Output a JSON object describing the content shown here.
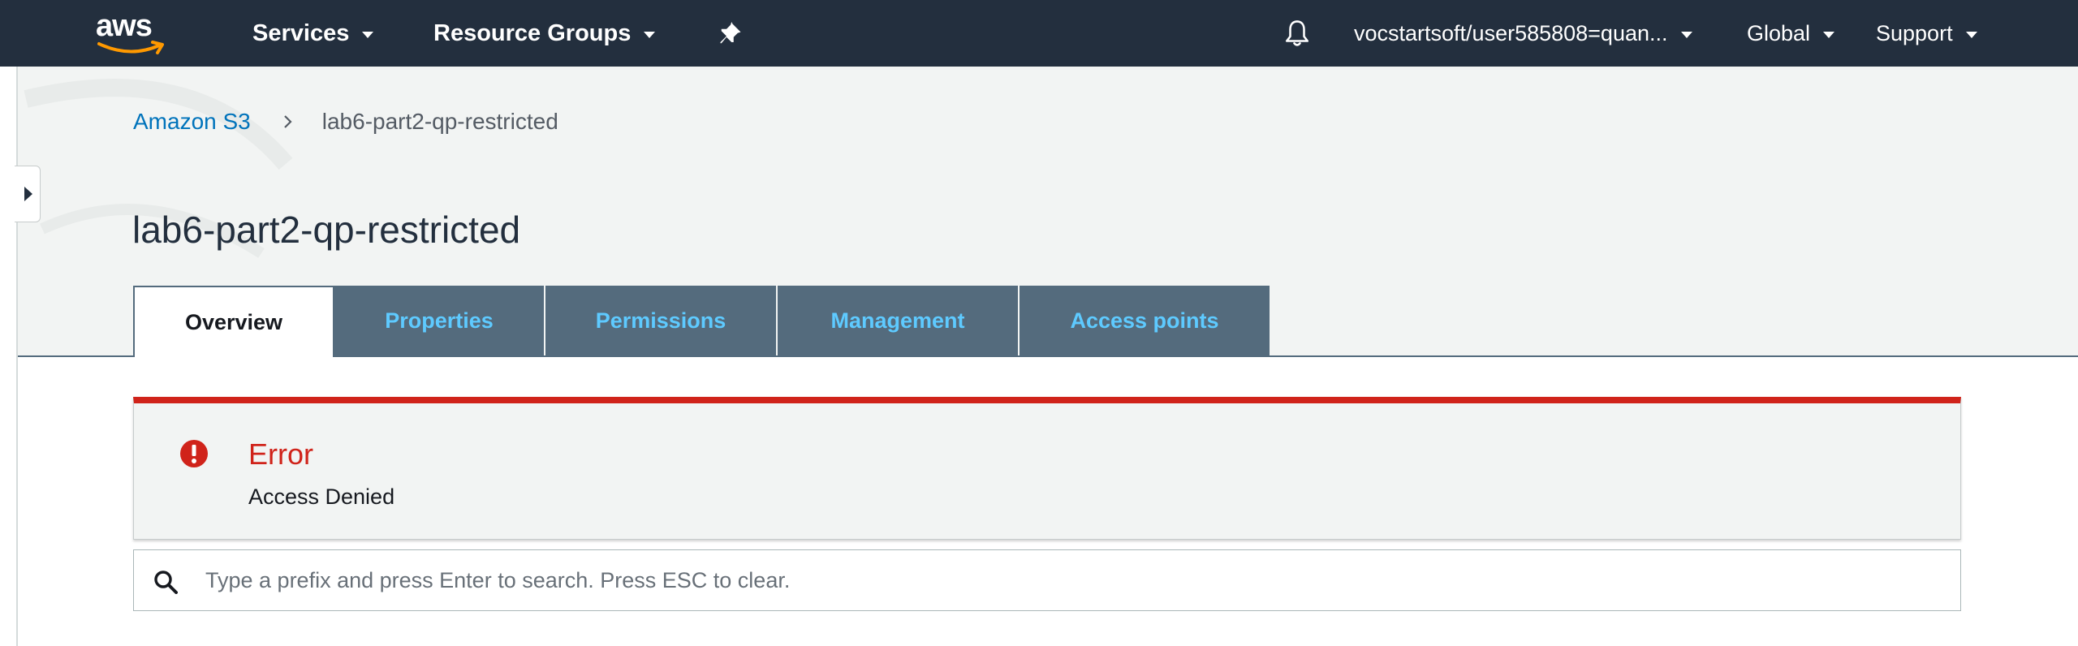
{
  "nav": {
    "brand": "aws",
    "services": "Services",
    "resource_groups": "Resource Groups",
    "account": "vocstartsoft/user585808=quan...",
    "region": "Global",
    "support": "Support",
    "icons": [
      "pin-icon",
      "bell-icon",
      "caret-down-icon"
    ]
  },
  "breadcrumb": {
    "root": "Amazon S3",
    "current": "lab6-part2-qp-restricted"
  },
  "page": {
    "title": "lab6-part2-qp-restricted"
  },
  "tabs": [
    {
      "label": "Overview",
      "active": true
    },
    {
      "label": "Properties",
      "active": false
    },
    {
      "label": "Permissions",
      "active": false
    },
    {
      "label": "Management",
      "active": false
    },
    {
      "label": "Access points",
      "active": false
    }
  ],
  "alert": {
    "title": "Error",
    "message": "Access Denied",
    "icon": "error-icon"
  },
  "search": {
    "placeholder": "Type a prefix and press Enter to search. Press ESC to clear.",
    "value": ""
  },
  "colors": {
    "nav_bg": "#232f3e",
    "tab_bg": "#546b7d",
    "tab_text": "#5ecaff",
    "error": "#d0231a",
    "link": "#0073bb"
  }
}
